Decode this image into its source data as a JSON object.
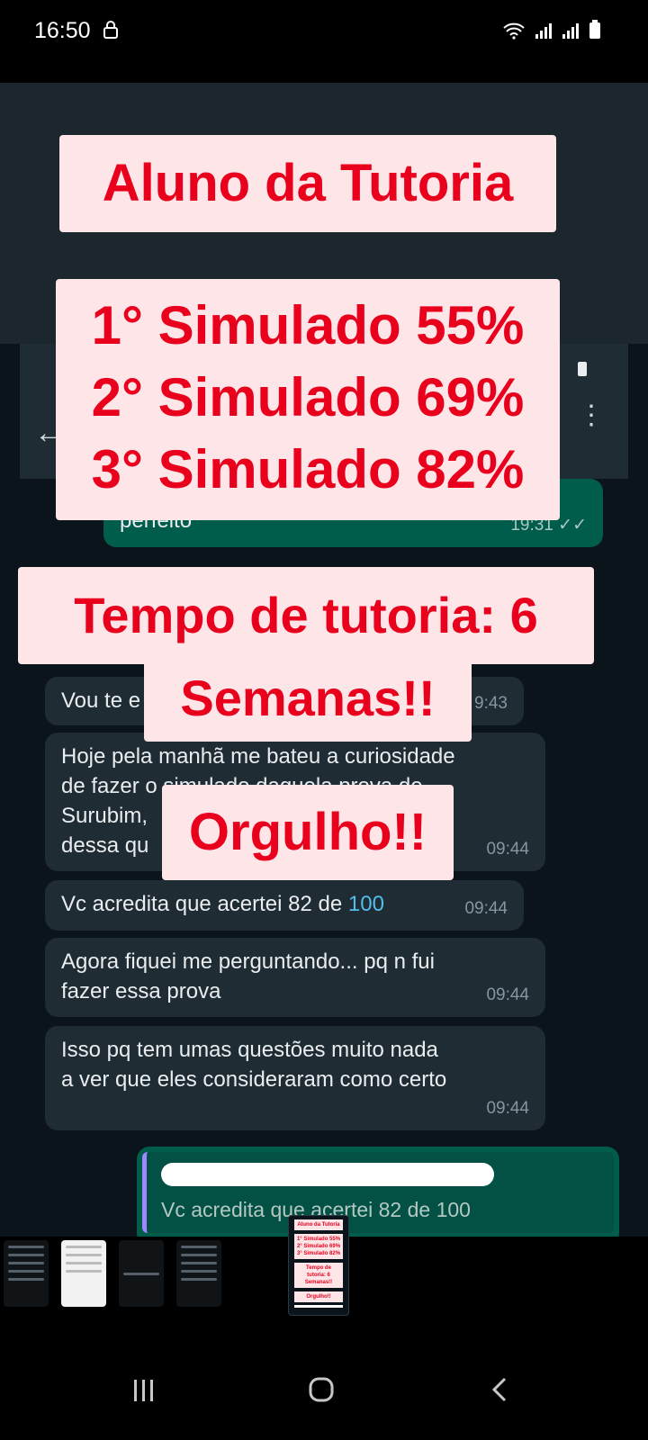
{
  "status_bar": {
    "time": "16:50",
    "icons": [
      "lock-icon",
      "wifi-icon",
      "signal-icon",
      "signal-icon",
      "battery-icon"
    ]
  },
  "colors": {
    "overlay_bg": "#fde5e8",
    "overlay_text": "#e8001c",
    "chat_bg": "#0b141a",
    "bubble_in": "#1f2c34",
    "bubble_out": "#005c4b"
  },
  "overlays": {
    "title": "Aluno da Tutoria",
    "scores": [
      "1° Simulado 55%",
      "2° Simulado 69%",
      "3° Simulado 82%"
    ],
    "tempo_line1": "Tempo de tutoria: 6",
    "tempo_line2": "Semanas!!",
    "orgulho": "Orgulho!!"
  },
  "chat": {
    "out_message": {
      "text": "perfeito",
      "time": "19:31"
    },
    "messages": [
      {
        "text": "Vou te e",
        "time": "9:43"
      },
      {
        "line1": "Hoje pela manhã me bateu a curiosidade",
        "line2": "de fazer o simulado daquela prova de",
        "line3": "Surubim,",
        "line4": "dessa qu",
        "time": "09:44"
      },
      {
        "text": "Vc acredita que acertei 82 de ",
        "link": "100",
        "time": "09:44"
      },
      {
        "line1": "Agora fiquei me perguntando... pq n fui",
        "line2": "fazer essa prova",
        "time": "09:44"
      },
      {
        "line1": "Isso pq tem umas questões muito nada",
        "line2": "a ver que eles consideraram como certo",
        "time": "09:44"
      }
    ],
    "reply_preview": "Vc acredita que acertei 82 de 100"
  },
  "thumbnail_mini": {
    "title": "Aluno da Tutoria",
    "scores": [
      "1° Simulado 55%",
      "2° Simulado 69%",
      "3° Simulado 82%"
    ],
    "tempo": "Tempo de tutoria: 6 Semanas!!",
    "orgulho": "Orgulho!!"
  },
  "nav_bar": {
    "recents": "recents-icon",
    "home": "home-icon",
    "back": "back-icon"
  }
}
